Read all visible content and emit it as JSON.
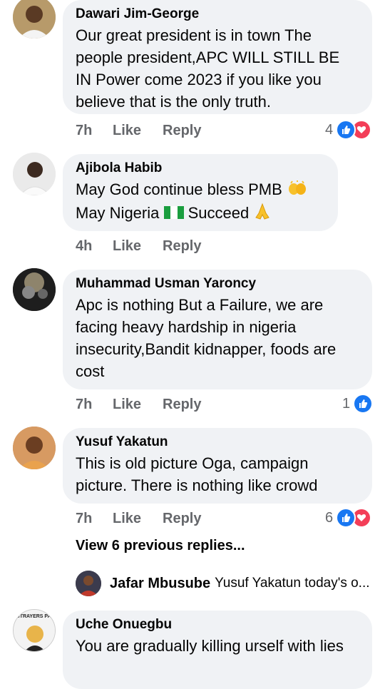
{
  "comments": [
    {
      "author": "Dawari Jim-George",
      "text": "Our great president is in town The people president,APC WILL STILL BE IN Power come 2023 if you like you believe that is the only truth.",
      "time": "7h",
      "like": "Like",
      "reply": "Reply",
      "reaction_count": "4",
      "reactions": [
        "like-icon",
        "love-icon"
      ]
    },
    {
      "author": "Ajibola Habib",
      "text_line1": "May God continue bless PMB",
      "text_line2a": "May Nigeria",
      "text_line2b": "Succeed",
      "time": "4h",
      "like": "Like",
      "reply": "Reply"
    },
    {
      "author": "Muhammad Usman Yaroncy",
      "text": "Apc is nothing But a Failure, we are facing heavy hardship in nigeria insecurity,Bandit kidnapper, foods are cost",
      "time": "7h",
      "like": "Like",
      "reply": "Reply",
      "reaction_count": "1",
      "reactions": [
        "like-icon"
      ]
    },
    {
      "author": "Yusuf Yakatun",
      "text": "This is old picture Oga, campaign picture. There is nothing like crowd",
      "time": "7h",
      "like": "Like",
      "reply": "Reply",
      "reaction_count": "6",
      "reactions": [
        "like-icon",
        "love-icon"
      ]
    },
    {
      "author": "Uche Onuegbu",
      "text": "You are gradually killing urself with lies"
    }
  ],
  "view_replies": "View 6 previous replies...",
  "latest_reply": {
    "author": "Jafar Mbusube",
    "text": "Yusuf Yakatun today's o..."
  },
  "avatar_caption": "STRAYERS PA"
}
